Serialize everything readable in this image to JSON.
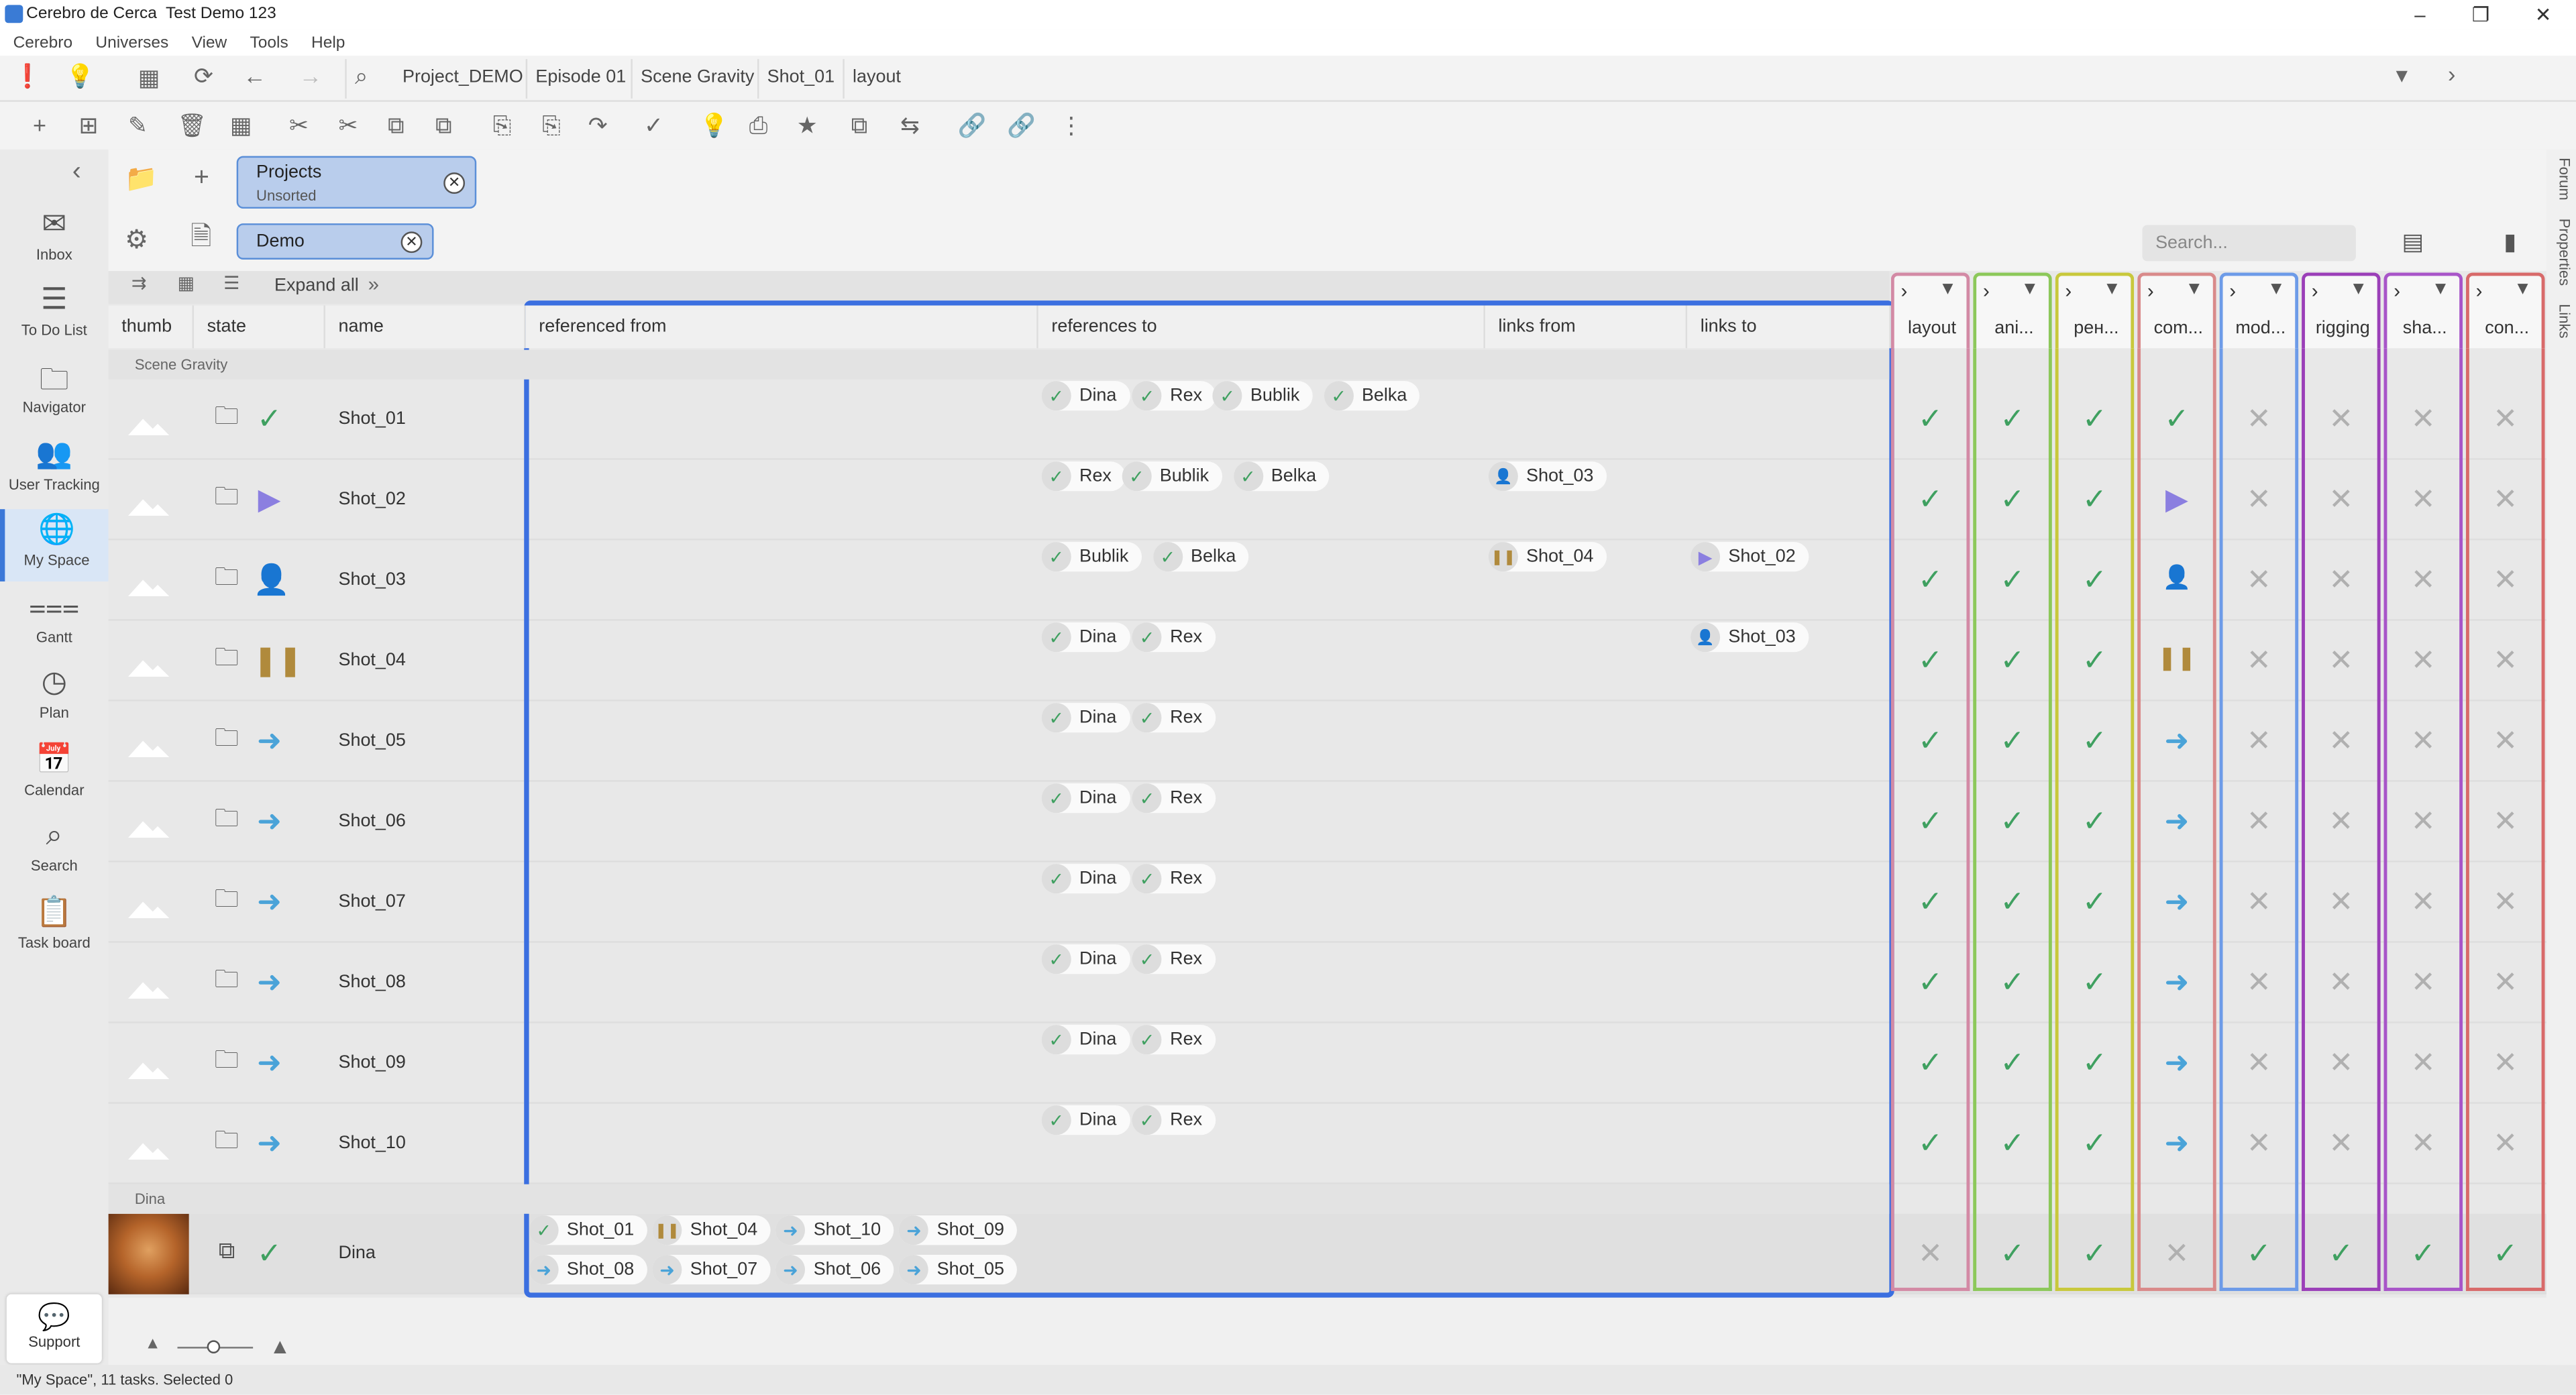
{
  "window": {
    "app_title": "Cerebro de Cerca",
    "context_title": "Test Demo 123"
  },
  "menu": [
    "Cerebro",
    "Universes",
    "View",
    "Tools",
    "Help"
  ],
  "breadcrumbs": [
    "Project_DEMO",
    "Episode 01",
    "Scene Gravity",
    "Shot_01",
    "layout"
  ],
  "nav": [
    {
      "label": "Inbox",
      "icon": "inbox-icon"
    },
    {
      "label": "To Do List",
      "icon": "list-icon"
    },
    {
      "label": "Navigator",
      "icon": "folder-icon"
    },
    {
      "label": "User Tracking",
      "icon": "users-icon"
    },
    {
      "label": "My Space",
      "icon": "globe-icon"
    },
    {
      "label": "Gantt",
      "icon": "gantt-icon"
    },
    {
      "label": "Plan",
      "icon": "plan-icon"
    },
    {
      "label": "Calendar",
      "icon": "calendar-icon"
    },
    {
      "label": "Search",
      "icon": "search-icon"
    },
    {
      "label": "Task board",
      "icon": "clipboard-icon"
    }
  ],
  "support_label": "Support",
  "filters": {
    "projects_title": "Projects",
    "projects_sub": "Unsorted",
    "demo": "Demo"
  },
  "search_placeholder": "Search...",
  "table_toolbar": {
    "expand_all": "Expand all"
  },
  "columns": [
    "thumb",
    "state",
    "name",
    "referenced from",
    "references to",
    "links from",
    "links to"
  ],
  "task_columns": [
    {
      "label": "layout",
      "color": "#d38aa5"
    },
    {
      "label": "ani...",
      "color": "#8cc85a"
    },
    {
      "label": "рен...",
      "color": "#c8c83c"
    },
    {
      "label": "com...",
      "color": "#d98a8a"
    },
    {
      "label": "mod...",
      "color": "#6d9be8"
    },
    {
      "label": "rigging",
      "color": "#9b3fb8"
    },
    {
      "label": "sha...",
      "color": "#a855c8"
    },
    {
      "label": "con...",
      "color": "#d86a6a"
    }
  ],
  "groups": {
    "scene": "Scene Gravity",
    "asset": "Dina"
  },
  "rows": [
    {
      "name": "Shot_01",
      "state": "check",
      "refs_to": [
        [
          "check",
          "Dina"
        ],
        [
          "check",
          "Rex"
        ],
        [
          "check",
          "Bublik"
        ],
        [
          "check",
          "Belka"
        ]
      ],
      "links_from": [],
      "links_to": [],
      "tasks": [
        "check",
        "check",
        "check",
        "check",
        "x",
        "x",
        "x",
        "x"
      ]
    },
    {
      "name": "Shot_02",
      "state": "play",
      "refs_to": [
        [
          "check",
          "Rex"
        ],
        [
          "check",
          "Bublik"
        ],
        [
          "check",
          "Belka"
        ]
      ],
      "links_from": [
        [
          "user",
          "Shot_03"
        ]
      ],
      "links_to": [],
      "tasks": [
        "check",
        "check",
        "check",
        "play",
        "x",
        "x",
        "x",
        "x"
      ]
    },
    {
      "name": "Shot_03",
      "state": "user",
      "refs_to": [
        [
          "check",
          "Bublik"
        ],
        [
          "check",
          "Belka"
        ]
      ],
      "links_from": [
        [
          "pause",
          "Shot_04"
        ]
      ],
      "links_to": [
        [
          "play",
          "Shot_02"
        ]
      ],
      "tasks": [
        "check",
        "check",
        "check",
        "user",
        "x",
        "x",
        "x",
        "x"
      ]
    },
    {
      "name": "Shot_04",
      "state": "pause",
      "refs_to": [
        [
          "check",
          "Dina"
        ],
        [
          "check",
          "Rex"
        ]
      ],
      "links_from": [],
      "links_to": [
        [
          "user",
          "Shot_03"
        ]
      ],
      "tasks": [
        "check",
        "check",
        "check",
        "pause",
        "x",
        "x",
        "x",
        "x"
      ]
    },
    {
      "name": "Shot_05",
      "state": "arrow",
      "refs_to": [
        [
          "check",
          "Dina"
        ],
        [
          "check",
          "Rex"
        ]
      ],
      "links_from": [],
      "links_to": [],
      "tasks": [
        "check",
        "check",
        "check",
        "arrow",
        "x",
        "x",
        "x",
        "x"
      ]
    },
    {
      "name": "Shot_06",
      "state": "arrow",
      "refs_to": [
        [
          "check",
          "Dina"
        ],
        [
          "check",
          "Rex"
        ]
      ],
      "links_from": [],
      "links_to": [],
      "tasks": [
        "check",
        "check",
        "check",
        "arrow",
        "x",
        "x",
        "x",
        "x"
      ]
    },
    {
      "name": "Shot_07",
      "state": "arrow",
      "refs_to": [
        [
          "check",
          "Dina"
        ],
        [
          "check",
          "Rex"
        ]
      ],
      "links_from": [],
      "links_to": [],
      "tasks": [
        "check",
        "check",
        "check",
        "arrow",
        "x",
        "x",
        "x",
        "x"
      ]
    },
    {
      "name": "Shot_08",
      "state": "arrow",
      "refs_to": [
        [
          "check",
          "Dina"
        ],
        [
          "check",
          "Rex"
        ]
      ],
      "links_from": [],
      "links_to": [],
      "tasks": [
        "check",
        "check",
        "check",
        "arrow",
        "x",
        "x",
        "x",
        "x"
      ]
    },
    {
      "name": "Shot_09",
      "state": "arrow",
      "refs_to": [
        [
          "check",
          "Dina"
        ],
        [
          "check",
          "Rex"
        ]
      ],
      "links_from": [],
      "links_to": [],
      "tasks": [
        "check",
        "check",
        "check",
        "arrow",
        "x",
        "x",
        "x",
        "x"
      ]
    },
    {
      "name": "Shot_10",
      "state": "arrow",
      "refs_to": [
        [
          "check",
          "Dina"
        ],
        [
          "check",
          "Rex"
        ]
      ],
      "links_from": [],
      "links_to": [],
      "tasks": [
        "check",
        "check",
        "check",
        "arrow",
        "x",
        "x",
        "x",
        "x"
      ]
    }
  ],
  "asset_row": {
    "name": "Dina",
    "state": "check",
    "ref_from_line1": [
      [
        "check",
        "Shot_01"
      ],
      [
        "pause",
        "Shot_04"
      ],
      [
        "arrow",
        "Shot_10"
      ],
      [
        "arrow",
        "Shot_09"
      ]
    ],
    "ref_from_line2": [
      [
        "arrow",
        "Shot_08"
      ],
      [
        "arrow",
        "Shot_07"
      ],
      [
        "arrow",
        "Shot_06"
      ],
      [
        "arrow",
        "Shot_05"
      ]
    ],
    "tasks": [
      "x",
      "check",
      "check",
      "x",
      "check",
      "check",
      "check",
      "check"
    ]
  },
  "status_bar": "\"My Space\", 11 tasks. Selected 0",
  "right_tabs": [
    "Forum",
    "Properties",
    "Links"
  ],
  "colors": {
    "accent": "#3b6fe0",
    "check": "#3fa060",
    "play": "#8b7fe0",
    "arrow": "#4aa3d8",
    "pause": "#b08a3c",
    "user": "#c8b440",
    "x": "#b0b0b0"
  }
}
